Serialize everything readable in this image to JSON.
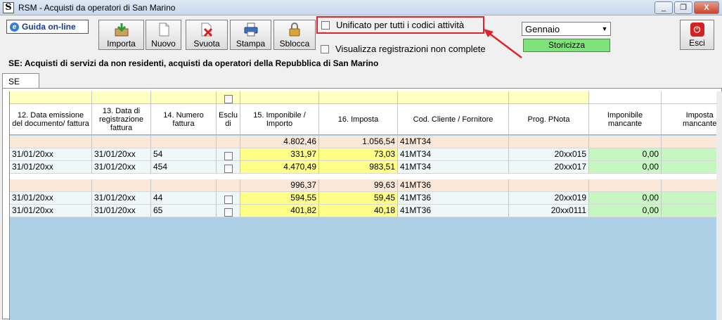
{
  "window": {
    "title": "RSM - Acquisti da operatori di San Marino",
    "app_icon": "S",
    "min_label": "_",
    "restore_label": "❐",
    "close_label": "X"
  },
  "toolbar": {
    "guida_label": "Guida on-line",
    "guida_icon": "e",
    "buttons": [
      "Importa",
      "Nuovo",
      "Svuota",
      "Stampa",
      "Sblocca"
    ],
    "unificato_label": "Unificato per tutti i codici attività",
    "visualizza_label": "Visualizza registrazioni non complete",
    "month_selected": "Gennaio",
    "storicizza_label": "Storicizza",
    "esci_label": "Esci",
    "esci_icon": "⏻"
  },
  "heading": "SE: Acquisti di servizi da non residenti, acquisti da operatori della Repubblica di San Marino",
  "tab_label": "SE",
  "columns": [
    "12. Data emissione del documento/ fattura",
    "13. Data di registrazione fattura",
    "14. Numero fattura",
    "Esclu di",
    "15. Imponibile / Importo",
    "16. Imposta",
    "Cod. Cliente / Fornitore",
    "Prog. PNota",
    "Imponibile mancante",
    "Imposta mancante"
  ],
  "groups": [
    {
      "imponibile": "4.802,46",
      "imposta": "1.056,54",
      "codice": "41MT34",
      "rows": [
        {
          "data_emissione": "31/01/20xx",
          "data_registrazione": "31/01/20xx",
          "numero": "54",
          "imponibile": "331,97",
          "imposta": "73,03",
          "codice": "41MT34",
          "pnota": "20xx015",
          "imp_mancante": "0,00"
        },
        {
          "data_emissione": "31/01/20xx",
          "data_registrazione": "31/01/20xx",
          "numero": "454",
          "imponibile": "4.470,49",
          "imposta": "983,51",
          "codice": "41MT34",
          "pnota": "20xx017",
          "imp_mancante": "0,00"
        }
      ]
    },
    {
      "imponibile": "996,37",
      "imposta": "99,63",
      "codice": "41MT36",
      "rows": [
        {
          "data_emissione": "31/01/20xx",
          "data_registrazione": "31/01/20xx",
          "numero": "44",
          "imponibile": "594,55",
          "imposta": "59,45",
          "codice": "41MT36",
          "pnota": "20xx019",
          "imp_mancante": "0,00"
        },
        {
          "data_emissione": "31/01/20xx",
          "data_registrazione": "31/01/20xx",
          "numero": "65",
          "imponibile": "401,82",
          "imposta": "40,18",
          "codice": "41MT36",
          "pnota": "20xx0111",
          "imp_mancante": "0,00"
        }
      ]
    }
  ],
  "colors": {
    "highlight_border": "#e0222b",
    "storicizza_bg": "#80e27a",
    "yellow_cell": "#ffff88",
    "green_cell": "#c6f7c0",
    "group_row": "#fbe8d9",
    "empty_grid": "#add0e6"
  }
}
